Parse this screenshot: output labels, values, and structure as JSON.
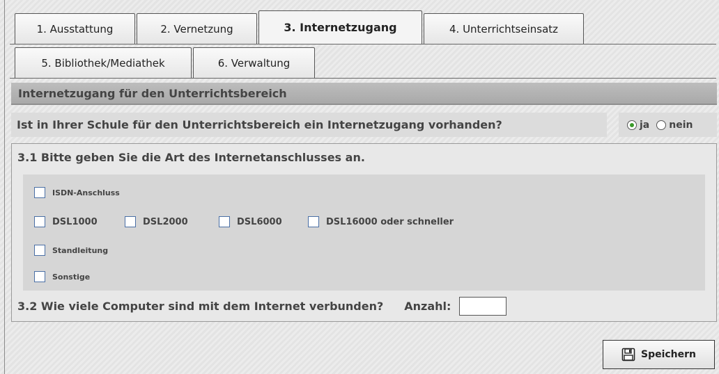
{
  "tabs": [
    {
      "label": "1. Ausstattung",
      "active": false
    },
    {
      "label": "2. Vernetzung",
      "active": false
    },
    {
      "label": "3. Internetzugang",
      "active": true
    },
    {
      "label": "4. Unterrichtseinsatz",
      "active": false
    },
    {
      "label": "5. Bibliothek/Mediathek",
      "active": false
    },
    {
      "label": "6. Verwaltung",
      "active": false
    }
  ],
  "section": {
    "title": "Internetzugang für den Unterrichtsbereich"
  },
  "question_access": {
    "text": "Ist in Ihrer Schule für den Unterrichtsbereich ein Internetzugang vorhanden?",
    "options": [
      {
        "label": "ja",
        "selected": true
      },
      {
        "label": "nein",
        "selected": false
      }
    ]
  },
  "q31": {
    "title": "3.1 Bitte geben Sie die Art des Internetanschlusses an.",
    "options": [
      {
        "label": "ISDN-Anschluss",
        "checked": false
      },
      {
        "label": "DSL1000",
        "checked": false
      },
      {
        "label": "DSL2000",
        "checked": false
      },
      {
        "label": "DSL6000",
        "checked": false
      },
      {
        "label": "DSL16000 oder schneller",
        "checked": false
      },
      {
        "label": "Standleitung",
        "checked": false
      },
      {
        "label": "Sonstige",
        "checked": false
      }
    ]
  },
  "q32": {
    "title": "3.2 Wie viele Computer sind mit dem Internet verbunden?",
    "count_label": "Anzahl:",
    "count_value": ""
  },
  "save_button": {
    "label": "Speichern",
    "icon": "floppy-disk-icon"
  },
  "colors": {
    "radio_selected": "#3a9a2a",
    "checkbox_border": "#4a6fa5"
  }
}
